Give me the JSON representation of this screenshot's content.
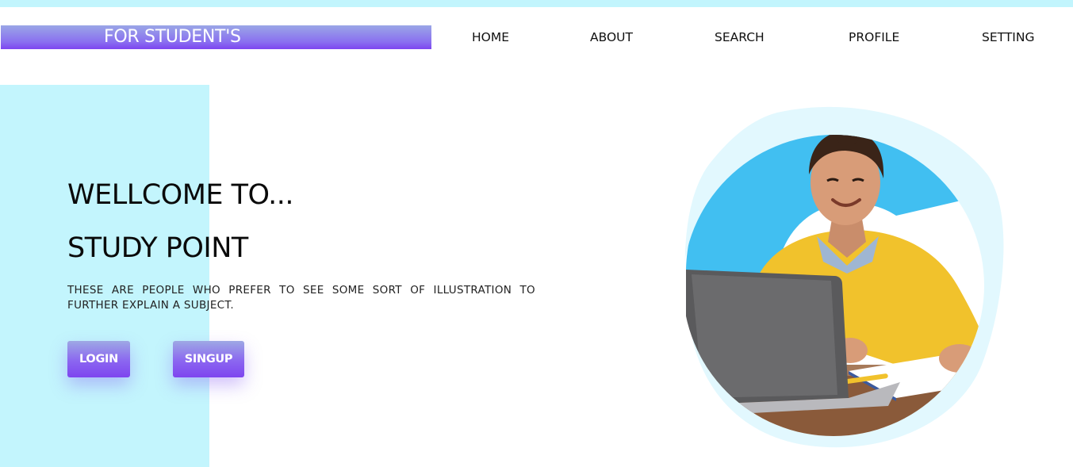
{
  "header": {
    "logo_text": "FOR STUDENT'S",
    "nav": [
      {
        "label": "HOME"
      },
      {
        "label": "ABOUT"
      },
      {
        "label": "SEARCH"
      },
      {
        "label": "PROFILE"
      },
      {
        "label": "SETTING"
      }
    ]
  },
  "hero": {
    "title_line1": "WELLCOME TO...",
    "title_line2": "STUDY POINT",
    "description": "THESE ARE PEOPLE WHO PREFER TO SEE SOME SORT OF ILLUSTRATION TO FURTHER EXPLAIN A SUBJECT.",
    "login_label": "LOGIN",
    "signup_label": "SINGUP"
  },
  "colors": {
    "accent_strip": "#c2f5fd",
    "button_gradient_top": "#9ea8e4",
    "button_gradient_bottom": "#7e45ef",
    "illustration_blue": "#41bff1",
    "illustration_blob": "#e2f8fe",
    "sweater_yellow": "#f1c22c"
  },
  "icons": {
    "hero_image": "student-with-laptop-illustration"
  }
}
